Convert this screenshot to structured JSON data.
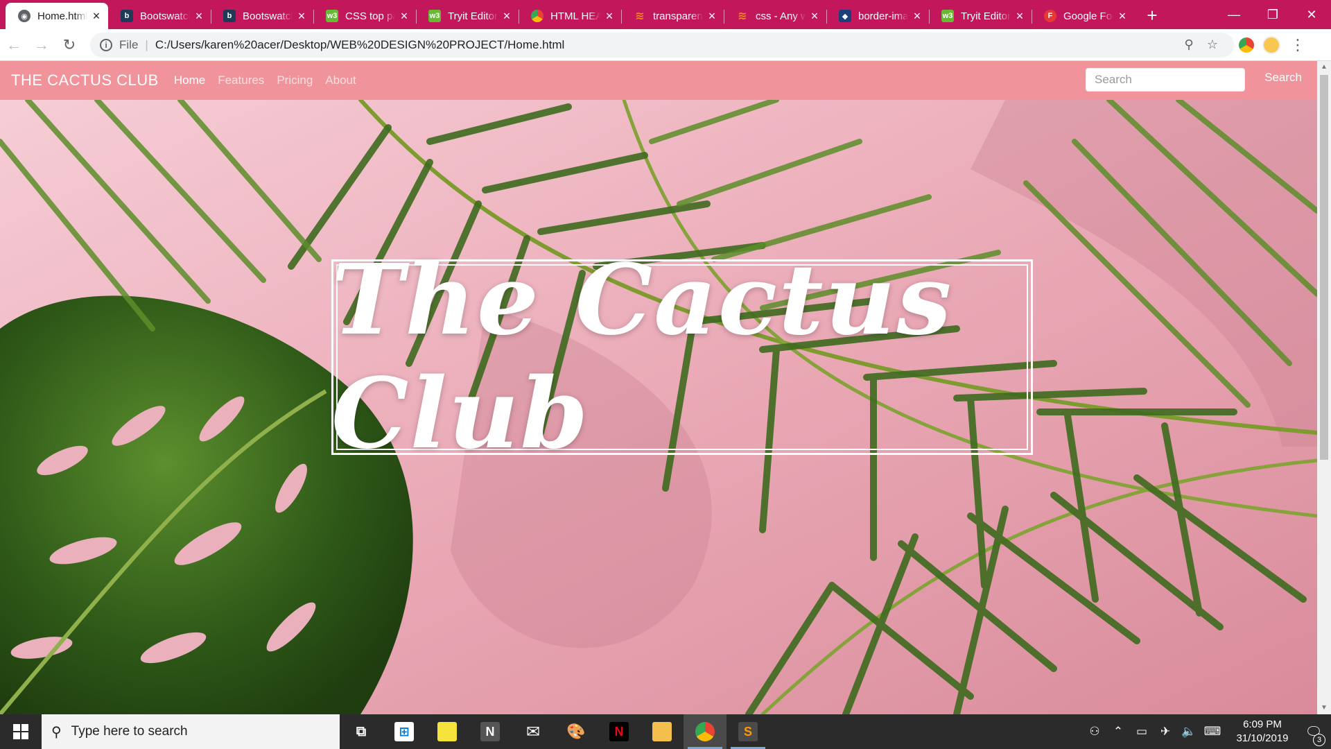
{
  "browser": {
    "tabs": [
      {
        "title": "Home.html",
        "favicon": "globe-icon",
        "active": true
      },
      {
        "title": "Bootswatch",
        "favicon": "bootswatch-icon"
      },
      {
        "title": "Bootswatch",
        "favicon": "bootswatch-icon"
      },
      {
        "title": "CSS top padding",
        "favicon": "w3schools-icon"
      },
      {
        "title": "Tryit Editor",
        "favicon": "w3schools-icon"
      },
      {
        "title": "HTML HEAD",
        "favicon": "chrome-icon"
      },
      {
        "title": "transparent",
        "favicon": "stackoverflow-icon"
      },
      {
        "title": "css - Any way",
        "favicon": "stackoverflow-icon"
      },
      {
        "title": "border-image",
        "favicon": "github-icon"
      },
      {
        "title": "Tryit Editor",
        "favicon": "w3schools-icon"
      },
      {
        "title": "Google Fonts",
        "favicon": "google-fonts-icon"
      }
    ],
    "new_tab": "+",
    "address": {
      "scheme": "File",
      "url": "C:/Users/karen%20acer/Desktop/WEB%20DESIGN%20PROJECT/Home.html"
    }
  },
  "site": {
    "brand": "THE CACTUS CLUB",
    "nav": [
      "Home",
      "Features",
      "Pricing",
      "About"
    ],
    "active_nav": "Home",
    "search_placeholder": "Search",
    "search_button": "Search",
    "hero_title": "The Cactus Club",
    "colors": {
      "navbar": "#f0939b",
      "hero_bg": "#f2bfca",
      "leaf": "#3f6b1f"
    }
  },
  "taskbar": {
    "search_placeholder": "Type here to search",
    "time": "6:09 PM",
    "date": "31/10/2019",
    "notification_count": "3"
  }
}
